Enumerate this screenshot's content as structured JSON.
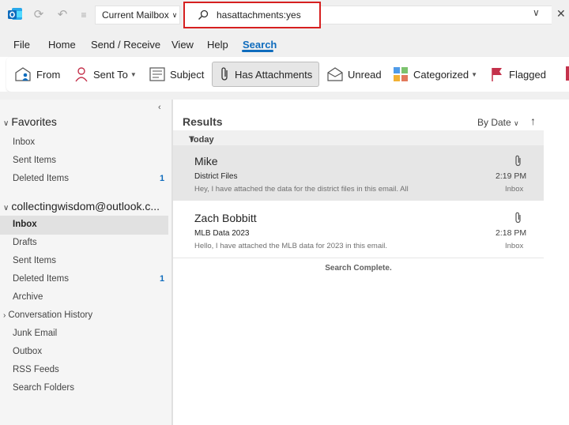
{
  "titlebar": {
    "scope": "Current Mailbox",
    "search_value": "hasattachments:yes"
  },
  "menu": [
    "File",
    "Home",
    "Send / Receive",
    "View",
    "Help",
    "Search"
  ],
  "ribbon": {
    "from": "From",
    "sent_to": "Sent To",
    "subject": "Subject",
    "has_attachments": "Has Attachments",
    "unread": "Unread",
    "categorized": "Categorized",
    "flagged": "Flagged"
  },
  "folders": {
    "favorites_label": "Favorites",
    "favorites": [
      {
        "name": "Inbox",
        "count": ""
      },
      {
        "name": "Sent Items",
        "count": ""
      },
      {
        "name": "Deleted Items",
        "count": "1"
      }
    ],
    "account_label": "collectingwisdom@outlook.c...",
    "account": [
      {
        "name": "Inbox",
        "count": ""
      },
      {
        "name": "Drafts",
        "count": ""
      },
      {
        "name": "Sent Items",
        "count": ""
      },
      {
        "name": "Deleted Items",
        "count": "1"
      },
      {
        "name": "Archive",
        "count": ""
      },
      {
        "name": "Conversation History",
        "count": ""
      },
      {
        "name": "Junk Email",
        "count": ""
      },
      {
        "name": "Outbox",
        "count": ""
      },
      {
        "name": "RSS Feeds",
        "count": ""
      },
      {
        "name": "Search Folders",
        "count": ""
      }
    ]
  },
  "list": {
    "heading": "Results",
    "sort": "By Date",
    "group": "Today",
    "messages": [
      {
        "sender": "Mike",
        "subject": "District Files",
        "preview": "Hey, I have attached the data for the district files in this email.  All",
        "time": "2:19 PM",
        "folder": "Inbox"
      },
      {
        "sender": "Zach Bobbitt",
        "subject": "MLB Data 2023",
        "preview": "Hello,  I have attached the MLB data for 2023 in this email.",
        "time": "2:18 PM",
        "folder": "Inbox"
      }
    ],
    "status": "Search Complete."
  },
  "colors": {
    "accent": "#0f6cbd",
    "highlight": "#d62020"
  }
}
